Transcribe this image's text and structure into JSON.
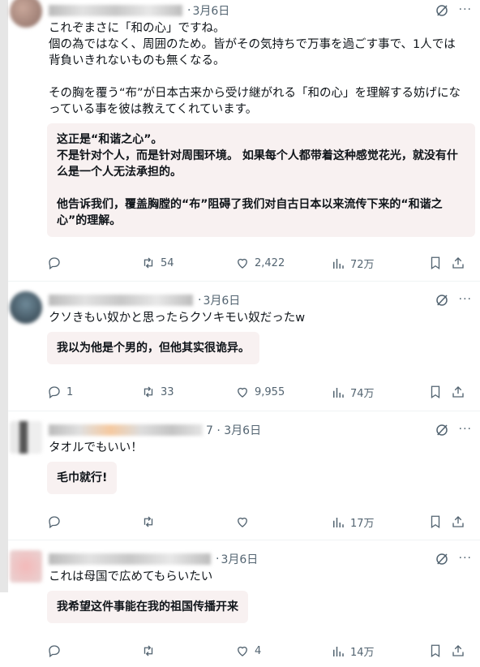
{
  "tweets": [
    {
      "date": "3月6日",
      "text": "これぞまさに「和の心」ですね。\n個の為ではなく、周囲のため。皆がその気持ちで万事を過ごす事で、1人では背負いきれないものも無くなる。\n\nその胸を覆う“布”が日本古来から受け継がれる「和の心」を理解する妨げになっている事を彼は教えてくれています。",
      "translation": "这正是“和谐之心”。\n不是针对个人，而是针对周围环境。 如果每个人都带着这种感觉花光，就没有什么是一个人无法承担的。\n\n他告诉我们，覆盖胸膛的“布”阻碍了我们对自古日本以来流传下来的“和谐之心”的理解。",
      "replies": "",
      "retweets": "54",
      "likes": "2,422",
      "views": "72万"
    },
    {
      "date": "3月6日",
      "text": "クソきもい奴かと思ったらクソキモい奴だったw",
      "translation": "我以为他是个男的，但他其实很诡异。",
      "replies": "1",
      "retweets": "33",
      "likes": "9,955",
      "views": "74万"
    },
    {
      "date": "7 · 3月6日",
      "text": "タオルでもいい！",
      "translation": "毛巾就行!",
      "replies": "",
      "retweets": "",
      "likes": "",
      "views": "17万"
    },
    {
      "date": "3月6日",
      "text": "これは母国で広めてもらいたい",
      "translation": "我希望这件事能在我的祖国传播开来",
      "replies": "",
      "retweets": "",
      "likes": "4",
      "views": "14万"
    }
  ],
  "colors": {
    "muted": "#536471",
    "translation_bg": "#f8f1f1"
  },
  "icons": [
    "grok-icon",
    "more-icon",
    "reply-icon",
    "retweet-icon",
    "like-icon",
    "views-icon",
    "bookmark-icon",
    "share-icon"
  ]
}
